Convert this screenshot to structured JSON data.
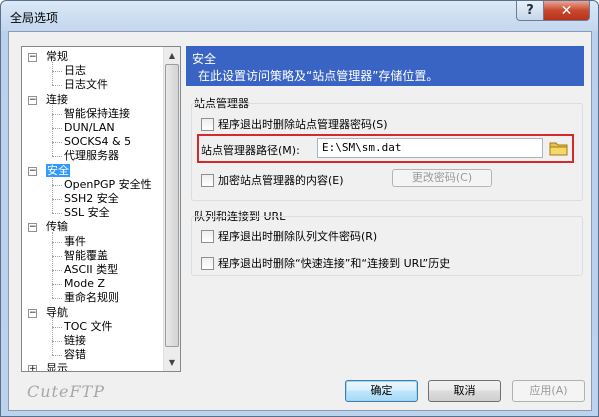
{
  "window": {
    "title": "全局选项"
  },
  "tree": {
    "items": [
      {
        "label": "常规",
        "level": 0,
        "expanded": true
      },
      {
        "label": "日志",
        "level": 1
      },
      {
        "label": "日志文件",
        "level": 1
      },
      {
        "label": "连接",
        "level": 0,
        "expanded": true
      },
      {
        "label": "智能保持连接",
        "level": 1
      },
      {
        "label": "DUN/LAN",
        "level": 1
      },
      {
        "label": "SOCKS4 & 5",
        "level": 1
      },
      {
        "label": "代理服务器",
        "level": 1
      },
      {
        "label": "安全",
        "level": 0,
        "expanded": true,
        "selected": true
      },
      {
        "label": "OpenPGP 安全性",
        "level": 1
      },
      {
        "label": "SSH2 安全",
        "level": 1
      },
      {
        "label": "SSL 安全",
        "level": 1
      },
      {
        "label": "传输",
        "level": 0,
        "expanded": true
      },
      {
        "label": "事件",
        "level": 1
      },
      {
        "label": "智能覆盖",
        "level": 1
      },
      {
        "label": "ASCII 类型",
        "level": 1
      },
      {
        "label": "Mode Z",
        "level": 1
      },
      {
        "label": "重命名规则",
        "level": 1
      },
      {
        "label": "导航",
        "level": 0,
        "expanded": true
      },
      {
        "label": "TOC 文件",
        "level": 1
      },
      {
        "label": "链接",
        "level": 1
      },
      {
        "label": "容错",
        "level": 1
      },
      {
        "label": "显示",
        "level": 0,
        "expanded": false
      }
    ]
  },
  "header": {
    "title": "安全",
    "description": "在此设置访问策略及“站点管理器”存储位置。"
  },
  "site_manager": {
    "group_title": "站点管理器",
    "delete_password_on_exit": "程序退出时删除站点管理器密码(S)",
    "path_label": "站点管理器路径(M):",
    "path_value": "E:\\SM\\sm.dat",
    "encrypt_label": "加密站点管理器的内容(E)",
    "change_password_button": "更改密码(C)"
  },
  "queue": {
    "group_title": "队列和连接到 URL",
    "delete_queue_password": "程序退出时删除队列文件密码(R)",
    "delete_history": "程序退出时删除“快速连接”和“连接到 URL”历史"
  },
  "footer": {
    "logo": "CuteFTP",
    "ok": "确定",
    "cancel": "取消",
    "apply": "应用(A)"
  },
  "colors": {
    "header_bg": "#3a64c4",
    "highlight_border": "#d62a2a",
    "selection": "#3399ff"
  },
  "icons": {
    "help": "help-icon",
    "close": "close-icon",
    "folder": "folder-icon"
  }
}
